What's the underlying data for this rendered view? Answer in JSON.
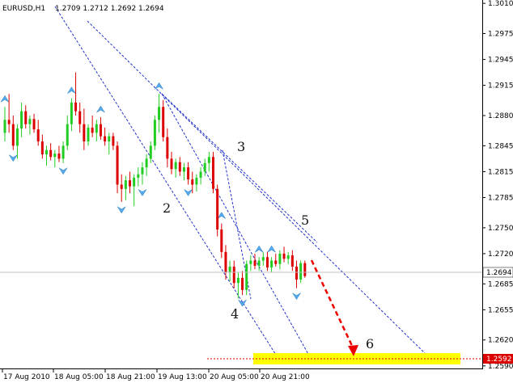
{
  "header": {
    "symbol": "EURUSD,H1",
    "ohlc": "1.2709 1.2712 1.2692 1.2694"
  },
  "colors": {
    "bull": "#22cc22",
    "bear": "#dd0000",
    "channel": "#2233cc",
    "fractal": "#55aaee",
    "target_zone": "#ffff00",
    "forecast_arrow": "#ee0000",
    "target_line": "#dd0000"
  },
  "chart_data": {
    "type": "candlestick",
    "symbol": "EURUSD",
    "timeframe": "H1",
    "ylim": [
      1.2587,
      1.3012
    ],
    "y_ticks": [
      "1.3010",
      "1.2975",
      "1.2945",
      "1.2915",
      "1.2880",
      "1.2845",
      "1.2815",
      "1.2785",
      "1.2750",
      "1.2720",
      "1.2685",
      "1.2655",
      "1.2620",
      "1.2590"
    ],
    "x_ticks": [
      "17 Aug 2010",
      "18 Aug 05:00",
      "18 Aug 21:00",
      "19 Aug 13:00",
      "20 Aug 05:00",
      "20 Aug 21:00"
    ],
    "current_price": "1.2694",
    "target_price": "1.2592",
    "wave_labels": [
      "2",
      "3",
      "4",
      "5",
      "6"
    ],
    "candles": [
      [
        1.286,
        1.289,
        1.285,
        1.2875
      ],
      [
        1.2875,
        1.2905,
        1.286,
        1.287
      ],
      [
        1.287,
        1.288,
        1.284,
        1.2845
      ],
      [
        1.2845,
        1.287,
        1.283,
        1.2865
      ],
      [
        1.2865,
        1.2895,
        1.2855,
        1.2885
      ],
      [
        1.2885,
        1.2892,
        1.2865,
        1.287
      ],
      [
        1.287,
        1.288,
        1.2858,
        1.2876
      ],
      [
        1.2876,
        1.2882,
        1.286,
        1.2864
      ],
      [
        1.2864,
        1.2875,
        1.2845,
        1.285
      ],
      [
        1.285,
        1.2858,
        1.283,
        1.2835
      ],
      [
        1.2835,
        1.2845,
        1.2822,
        1.284
      ],
      [
        1.284,
        1.2848,
        1.2828,
        1.2832
      ],
      [
        1.2832,
        1.284,
        1.282,
        1.2836
      ],
      [
        1.2836,
        1.2845,
        1.2826,
        1.283
      ],
      [
        1.283,
        1.285,
        1.2825,
        1.2845
      ],
      [
        1.2845,
        1.288,
        1.284,
        1.287
      ],
      [
        1.287,
        1.29,
        1.2862,
        1.2895
      ],
      [
        1.2895,
        1.293,
        1.288,
        1.2885
      ],
      [
        1.2885,
        1.2895,
        1.286,
        1.287
      ],
      [
        1.287,
        1.2888,
        1.284,
        1.285
      ],
      [
        1.285,
        1.287,
        1.2845,
        1.2866
      ],
      [
        1.2866,
        1.288,
        1.2855,
        1.286
      ],
      [
        1.286,
        1.2875,
        1.285,
        1.287
      ],
      [
        1.287,
        1.2878,
        1.2852,
        1.2856
      ],
      [
        1.2856,
        1.2866,
        1.2845,
        1.285
      ],
      [
        1.285,
        1.286,
        1.2835,
        1.2856
      ],
      [
        1.2856,
        1.286,
        1.284,
        1.2845
      ],
      [
        1.2845,
        1.285,
        1.279,
        1.28
      ],
      [
        1.28,
        1.2812,
        1.278,
        1.2795
      ],
      [
        1.2795,
        1.281,
        1.2782,
        1.2805
      ],
      [
        1.2805,
        1.2815,
        1.279,
        1.2798
      ],
      [
        1.2798,
        1.2812,
        1.2775,
        1.2808
      ],
      [
        1.2808,
        1.282,
        1.2798,
        1.2812
      ],
      [
        1.2812,
        1.2826,
        1.28,
        1.282
      ],
      [
        1.282,
        1.2835,
        1.281,
        1.283
      ],
      [
        1.283,
        1.285,
        1.2825,
        1.2845
      ],
      [
        1.2845,
        1.288,
        1.284,
        1.2875
      ],
      [
        1.2875,
        1.2905,
        1.286,
        1.289
      ],
      [
        1.289,
        1.2898,
        1.285,
        1.2855
      ],
      [
        1.2855,
        1.2865,
        1.282,
        1.283
      ],
      [
        1.283,
        1.2838,
        1.2812,
        1.2818
      ],
      [
        1.2818,
        1.283,
        1.2808,
        1.2826
      ],
      [
        1.2826,
        1.2832,
        1.281,
        1.2815
      ],
      [
        1.2815,
        1.2825,
        1.2805,
        1.282
      ],
      [
        1.282,
        1.2826,
        1.28,
        1.2806
      ],
      [
        1.2806,
        1.2815,
        1.279,
        1.28
      ],
      [
        1.28,
        1.2812,
        1.2792,
        1.2808
      ],
      [
        1.2808,
        1.282,
        1.28,
        1.2815
      ],
      [
        1.2815,
        1.283,
        1.281,
        1.2825
      ],
      [
        1.2825,
        1.2838,
        1.2815,
        1.2832
      ],
      [
        1.2832,
        1.2838,
        1.279,
        1.2795
      ],
      [
        1.2795,
        1.28,
        1.274,
        1.2748
      ],
      [
        1.2748,
        1.2755,
        1.2715,
        1.2722
      ],
      [
        1.2722,
        1.273,
        1.269,
        1.2698
      ],
      [
        1.2698,
        1.2712,
        1.2688,
        1.2705
      ],
      [
        1.2705,
        1.2712,
        1.268,
        1.2686
      ],
      [
        1.2686,
        1.2698,
        1.2668,
        1.2692
      ],
      [
        1.2692,
        1.27,
        1.2672,
        1.2678
      ],
      [
        1.2678,
        1.2712,
        1.2672,
        1.2708
      ],
      [
        1.2708,
        1.2718,
        1.27,
        1.2712
      ],
      [
        1.2712,
        1.272,
        1.2702,
        1.2706
      ],
      [
        1.2706,
        1.2716,
        1.27,
        1.2712
      ],
      [
        1.2712,
        1.2722,
        1.2706,
        1.2716
      ],
      [
        1.2716,
        1.2722,
        1.27,
        1.2704
      ],
      [
        1.2704,
        1.2716,
        1.2698,
        1.2712
      ],
      [
        1.2712,
        1.272,
        1.2705,
        1.2708
      ],
      [
        1.2708,
        1.2724,
        1.2702,
        1.272
      ],
      [
        1.272,
        1.2728,
        1.271,
        1.2714
      ],
      [
        1.2714,
        1.2722,
        1.2708,
        1.2718
      ],
      [
        1.2718,
        1.2724,
        1.27,
        1.2705
      ],
      [
        1.2705,
        1.2712,
        1.268,
        1.269
      ],
      [
        1.269,
        1.2712,
        1.2686,
        1.2709
      ],
      [
        1.2709,
        1.2712,
        1.2692,
        1.2694
      ]
    ]
  }
}
